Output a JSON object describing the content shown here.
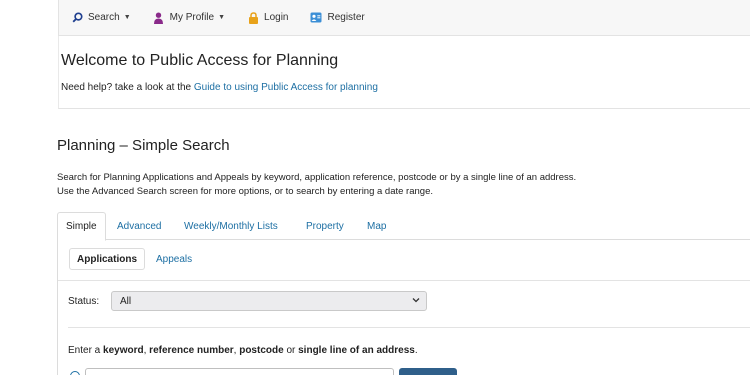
{
  "nav": {
    "search": "Search",
    "my_profile": "My Profile",
    "login": "Login",
    "register": "Register"
  },
  "welcome": {
    "title": "Welcome to Public Access for Planning",
    "help_prefix": "Need help? take a look at the ",
    "help_link": "Guide to using Public Access for planning"
  },
  "simple_search": {
    "title": "Planning – Simple Search",
    "desc_line1": "Search for Planning Applications and Appeals by keyword, application reference, postcode or by a single line of an address.",
    "desc_line2": "Use the Advanced Search screen for more options, or to search by entering a date range."
  },
  "tabs": [
    "Simple",
    "Advanced",
    "Weekly/Monthly Lists",
    "Property",
    "Map"
  ],
  "subtabs": [
    "Applications",
    "Appeals"
  ],
  "status": {
    "label": "Status:",
    "selected": "All"
  },
  "instruction": {
    "p1": "Enter a ",
    "b1": "keyword",
    "p2": ", ",
    "b2": "reference number",
    "p3": ", ",
    "b3": "postcode",
    "p4": " or ",
    "b4": "single line of an address",
    "p5": "."
  },
  "colors": {
    "link": "#1d6fa3",
    "button": "#2f5f8a",
    "profile_icon": "#8a2a8a",
    "login_icon": "#e8a21a",
    "register_icon": "#3c8fd6"
  }
}
